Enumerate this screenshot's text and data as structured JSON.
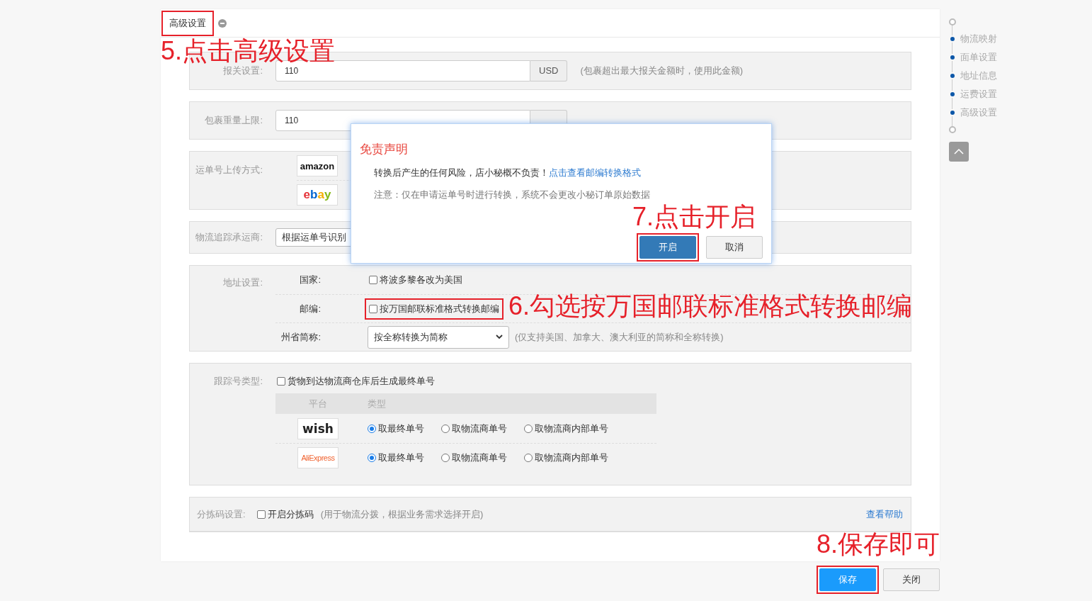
{
  "tab": {
    "label": "高级设置",
    "highlighted": true
  },
  "sections": [
    {
      "kind": "input",
      "label": "报关设置:",
      "value": "110",
      "unit": "USD",
      "hint": "(包裹超出最大报关金额时，使用此金额)"
    },
    {
      "kind": "input",
      "label": "包裹重量上限:",
      "value": "110"
    },
    {
      "kind": "logos",
      "label": "运单号上传方式:",
      "logos": [
        "amazon",
        "ebay"
      ]
    },
    {
      "kind": "select",
      "label": "物流追踪承运商:",
      "value": "根据运单号识别"
    },
    {
      "kind": "address",
      "label": "地址设置:",
      "rows": [
        {
          "kind": "checkbox",
          "label": "国家:",
          "text": "将波多黎各改为美国",
          "checked": false,
          "highlighted": false
        },
        {
          "kind": "checkbox",
          "label": "邮编:",
          "text": "按万国邮联标准格式转换邮编",
          "checked": false,
          "highlighted": true
        },
        {
          "kind": "select",
          "label": "州省简称:",
          "value": "按全称转换为简称",
          "hint": "(仅支持美国、加拿大、澳大利亚的简称和全称转换)"
        }
      ]
    },
    {
      "kind": "tracking",
      "label": "跟踪号类型:",
      "checkbox": {
        "text": "货物到达物流商仓库后生成最终单号",
        "checked": false
      },
      "columns": [
        "平台",
        "类型"
      ],
      "rows": [
        {
          "platform": "wish",
          "options": [
            {
              "label": "取最终单号",
              "selected": true
            },
            {
              "label": "取物流商单号",
              "selected": false
            },
            {
              "label": "取物流商内部单号",
              "selected": false
            }
          ]
        },
        {
          "platform": "AliExpress",
          "options": [
            {
              "label": "取最终单号",
              "selected": true
            },
            {
              "label": "取物流商单号",
              "selected": false
            },
            {
              "label": "取物流商内部单号",
              "selected": false
            }
          ]
        }
      ]
    },
    {
      "kind": "sorting",
      "label": "分拣码设置:",
      "checkbox": {
        "text": "开启分拣码",
        "checked": false
      },
      "hint": "(用于物流分拨，根据业务需求选择开启)",
      "link": "查看帮助"
    }
  ],
  "modal": {
    "title": "免责声明",
    "message": "转换后产生的任何风险，店小秘概不负责！",
    "link": "点击查看邮编转换格式",
    "note": "注意：仅在申请运单号时进行转换，系统不会更改小秘订单原始数据",
    "buttons": [
      {
        "label": "开启",
        "kind": "primary",
        "highlighted": true
      },
      {
        "label": "取消",
        "kind": "default",
        "highlighted": false
      }
    ]
  },
  "nav": {
    "items": [
      "物流映射",
      "面单设置",
      "地址信息",
      "运费设置",
      "高级设置"
    ]
  },
  "footer_buttons": [
    {
      "label": "保存",
      "kind": "primary",
      "highlighted": true
    },
    {
      "label": "关闭",
      "kind": "default",
      "highlighted": false
    }
  ],
  "annotations": [
    "5.点击高级设置",
    "7.点击开启",
    "6.勾选按万国邮联标准格式转换邮编",
    "8.保存即可"
  ]
}
